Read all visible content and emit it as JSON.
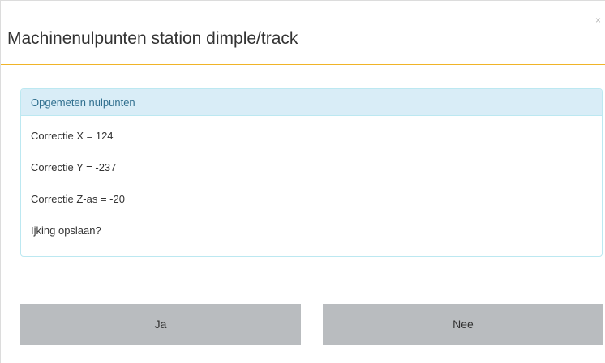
{
  "dialog": {
    "title": "Machinenulpunten station dimple/track",
    "close_label": "×"
  },
  "panel": {
    "heading": "Opgemeten nulpunten",
    "lines": [
      "Correctie X = 124",
      "Correctie Y = -237",
      "Correctie Z-as = -20",
      "Ijking opslaan?"
    ]
  },
  "buttons": {
    "yes_label": "Ja",
    "no_label": "Nee",
    "color": "#b9bcbf"
  },
  "colors": {
    "header_divider": "#f0b428",
    "panel_heading_bg": "#d9edf7",
    "panel_heading_text": "#31708f",
    "panel_border": "#bce8f1"
  }
}
